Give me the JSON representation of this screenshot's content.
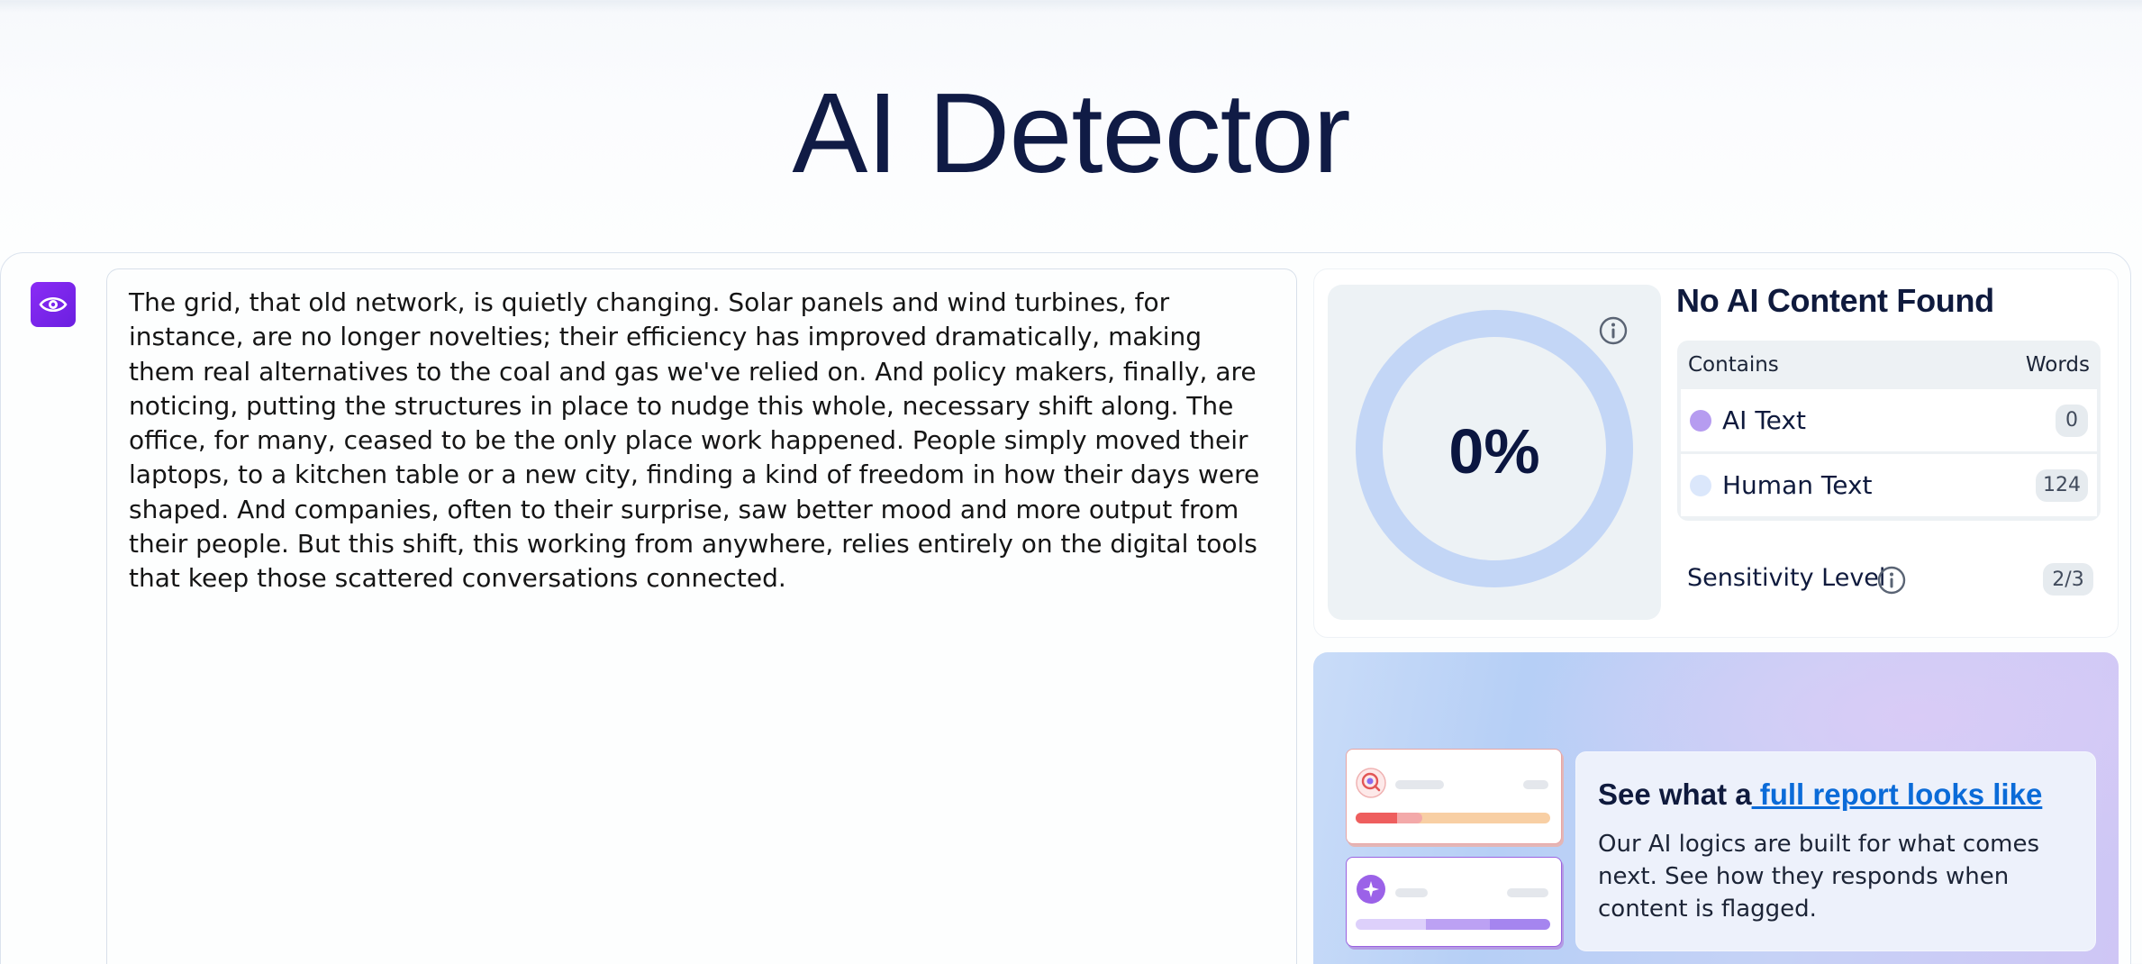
{
  "header": {
    "title": "AI Detector"
  },
  "editor": {
    "text": "The grid, that old network, is quietly changing. Solar panels and wind turbines, for instance, are no longer novelties; their efficiency has improved dramatically, making them real alternatives to the coal and gas we've relied on. And policy makers, finally, are noticing, putting the structures in place to nudge this whole, necessary shift along. The office, for many, ceased to be the only place work happened. People simply moved their laptops, to a kitchen table or a new city, finding a kind of freedom in how their days were shaped. And companies, often to their surprise, saw better mood and more output from their people. But this shift, this working from anywhere, relies entirely on the digital tools that keep those scattered conversations connected."
  },
  "result": {
    "score_text": "0%",
    "score_fraction": 0,
    "title": "No AI Content Found",
    "table": {
      "col_contains": "Contains",
      "col_words": "Words",
      "rows": [
        {
          "label": "AI Text",
          "count": "0",
          "color": "#b69cf0"
        },
        {
          "label": "Human Text",
          "count": "124",
          "color": "#dbe7fb"
        }
      ]
    },
    "sensitivity": {
      "label": "Sensitivity Level",
      "value": "2/3"
    },
    "colors": {
      "ring": "#c3d6f6",
      "panel": "#edf2f5",
      "accent": "#7b26ee"
    }
  },
  "promo": {
    "title_prefix": "See what a",
    "title_link": " full report looks like",
    "body": "Our AI logics are built for what comes next. See how they responds when content is flagged."
  },
  "icons": [
    "eye-icon",
    "info-icon",
    "search-report-icon",
    "sparkle-icon"
  ]
}
